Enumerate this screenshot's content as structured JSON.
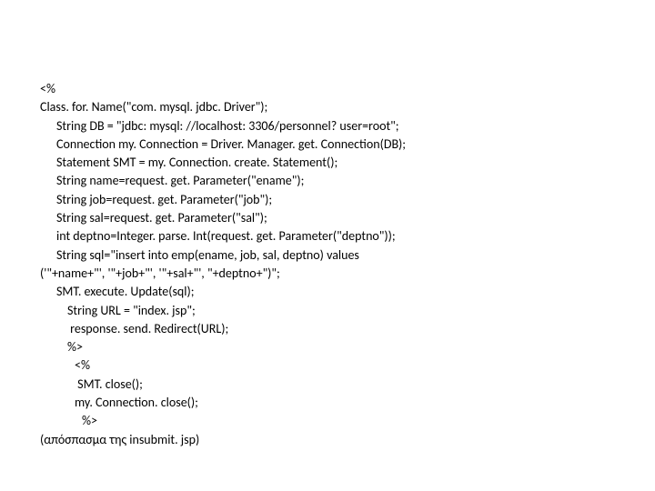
{
  "lines": [
    {
      "cls": "i0",
      "text": "<%"
    },
    {
      "cls": "i0",
      "text": "Class. for. Name(\"com. mysql. jdbc. Driver\");"
    },
    {
      "cls": "i1",
      "text": "String DB = \"jdbc: mysql: //localhost: 3306/personnel? user=root\";"
    },
    {
      "cls": "i1",
      "text": "Connection my. Connection = Driver. Manager. get. Connection(DB);"
    },
    {
      "cls": "i1",
      "text": "Statement SMT = my. Connection. create. Statement();"
    },
    {
      "cls": "i1",
      "text": "String name=request. get. Parameter(\"ename\");"
    },
    {
      "cls": "i1",
      "text": "String job=request. get. Parameter(\"job\");"
    },
    {
      "cls": "i1",
      "text": "String sal=request. get. Parameter(\"sal\");"
    },
    {
      "cls": "i1",
      "text": "int deptno=Integer. parse. Int(request. get. Parameter(\"deptno\"));"
    },
    {
      "cls": "i1",
      "text": "String sql=\"insert into emp(ename, job, sal, deptno) values"
    },
    {
      "cls": "i0",
      "text": "('\"+name+\"', '\"+job+\"', '\"+sal+\"', \"+deptno+\")\";"
    },
    {
      "cls": "i1",
      "text": "SMT. execute. Update(sql);"
    },
    {
      "cls": "i2",
      "text": "String URL = \"index. jsp\";"
    },
    {
      "cls": "i2",
      "text": " response. send. Redirect(URL);"
    },
    {
      "cls": "i2",
      "text": "%>"
    },
    {
      "cls": "i3",
      "text": "<%"
    },
    {
      "cls": "i3",
      "text": " SMT. close();"
    },
    {
      "cls": "i3",
      "text": "my. Connection. close();"
    },
    {
      "cls": "i4",
      "text": "%>"
    },
    {
      "cls": "i0",
      "text": "(απόσπασμα της insubmit. jsp)"
    }
  ]
}
